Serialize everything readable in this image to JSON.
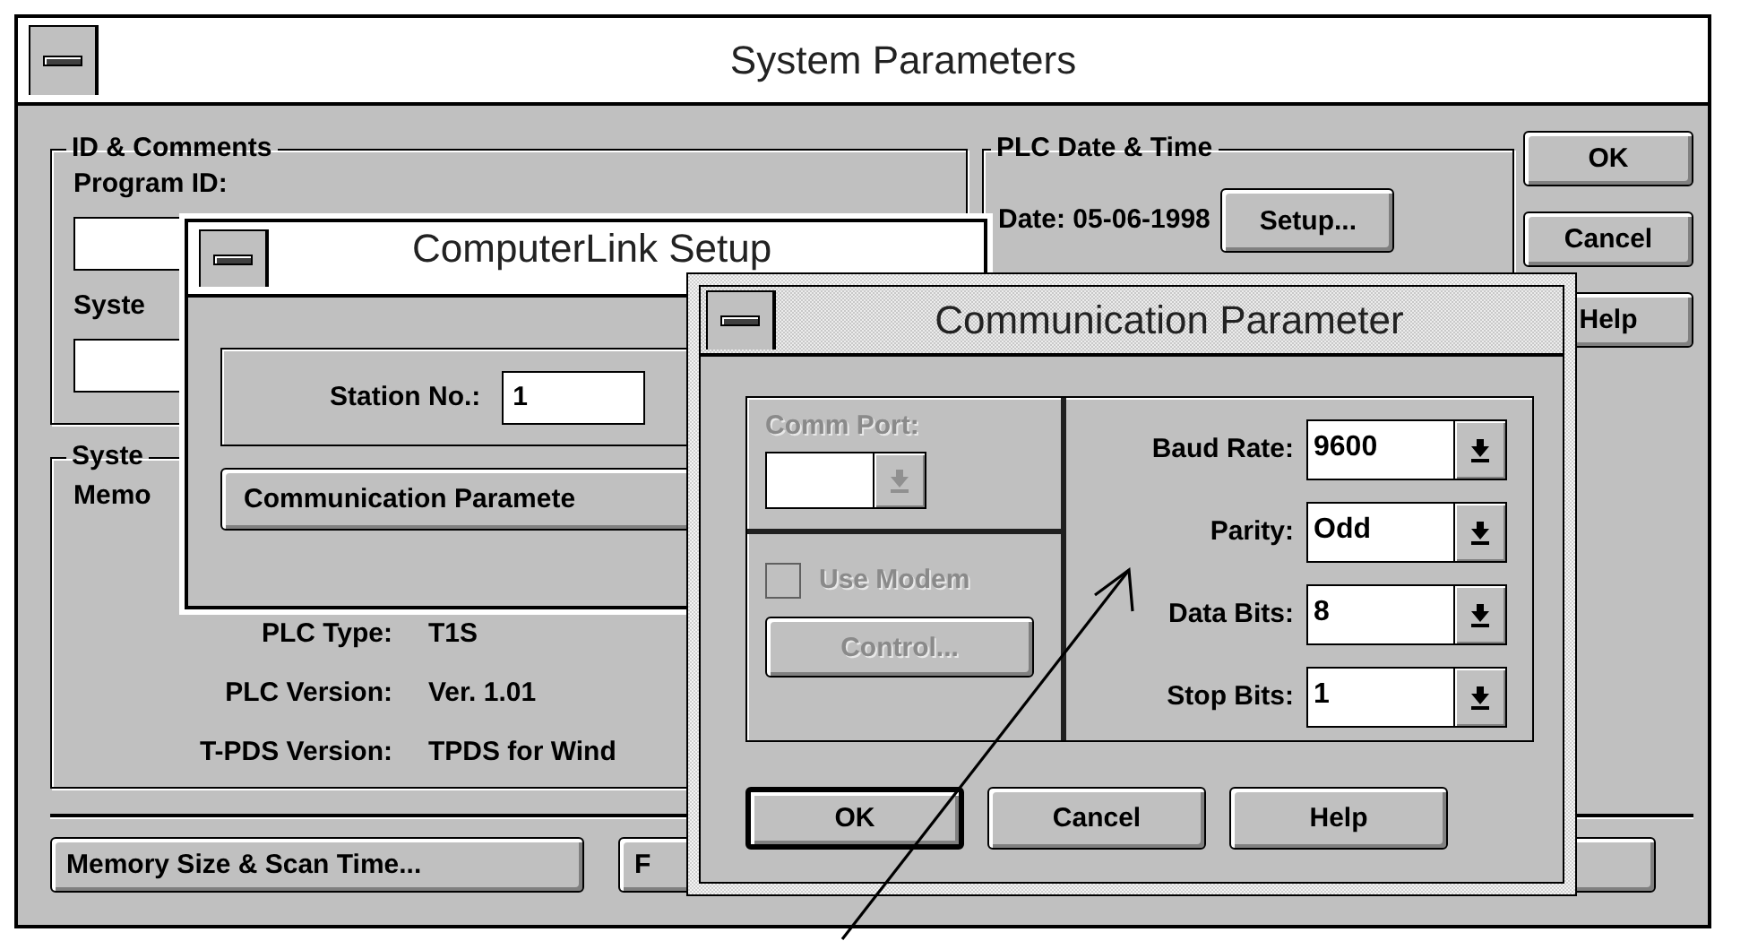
{
  "main_window": {
    "title": "System Parameters",
    "id_comments": {
      "title": "ID & Comments",
      "program_id_label": "Program ID:",
      "system_label": "Syste"
    },
    "system_group": {
      "title": "Syste",
      "memory_label": "Memo",
      "rows": [
        {
          "label": "PLC Type:",
          "value": "T1S"
        },
        {
          "label": "PLC Version:",
          "value": "Ver. 1.01"
        },
        {
          "label": "T-PDS Version:",
          "value": "TPDS for Wind"
        }
      ]
    },
    "plc_date_time": {
      "title": "PLC Date & Time",
      "date": "Date: 05-06-1998",
      "button": "Setup..."
    },
    "buttons": [
      {
        "label": "OK"
      },
      {
        "label": "Cancel"
      },
      {
        "label": "Help"
      }
    ],
    "bottom_buttons": [
      "Memory Size & Scan Time...",
      "F"
    ]
  },
  "computerlink_window": {
    "title": "ComputerLink Setup",
    "station_label": "Station No.:",
    "station_value": "1",
    "button": "Communication Paramete"
  },
  "comm_window": {
    "title": "Communication Parameter",
    "comm_port": {
      "label": "Comm Port:",
      "disabled": true
    },
    "use_modem": {
      "label": "Use Modem",
      "checked": false,
      "disabled": true
    },
    "control_button": {
      "label": "Control...",
      "disabled": true
    },
    "fields": [
      {
        "label": "Baud Rate:",
        "value": "9600"
      },
      {
        "label": "Parity:",
        "value": "Odd"
      },
      {
        "label": "Data Bits:",
        "value": "8"
      },
      {
        "label": "Stop Bits:",
        "value": "1"
      }
    ],
    "buttons": [
      {
        "label": "OK",
        "default": true
      },
      {
        "label": "Cancel",
        "default": false
      },
      {
        "label": "Help",
        "default": false
      }
    ]
  }
}
